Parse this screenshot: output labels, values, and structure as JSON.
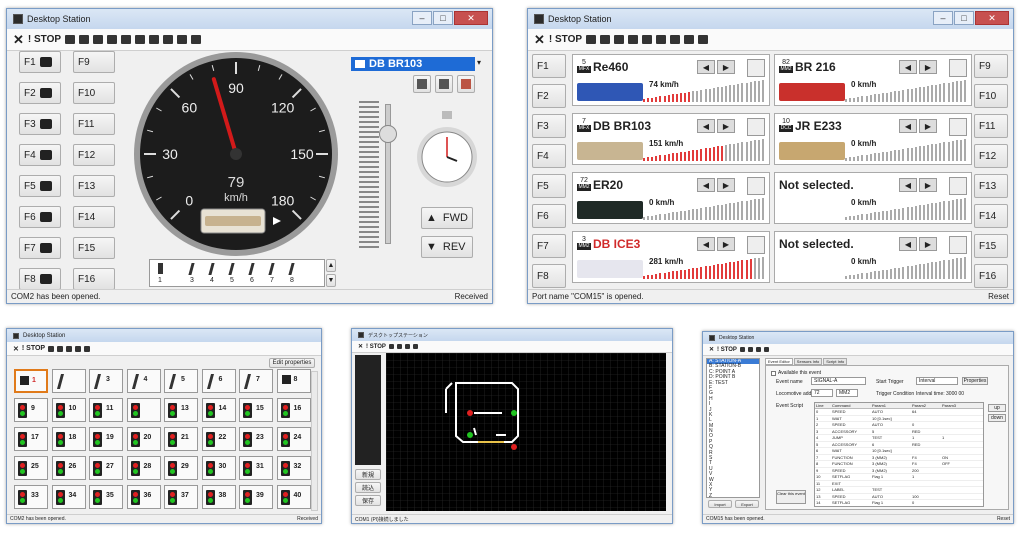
{
  "app_title": "Desktop Station",
  "toolbar": {
    "close": "✕",
    "stop": "! STOP"
  },
  "win1": {
    "f_left": [
      "F1",
      "F2",
      "F3",
      "F4",
      "F5",
      "F6",
      "F7",
      "F8"
    ],
    "f_right": [
      "F9",
      "F10",
      "F11",
      "F12",
      "F13",
      "F14",
      "F15",
      "F16"
    ],
    "loco_select": "DB BR103",
    "gauge_ticks": [
      "0",
      "30",
      "60",
      "90",
      "120",
      "150",
      "180"
    ],
    "speed": "79",
    "unit": "km/h",
    "fwd": "FWD",
    "rev": "REV",
    "accessory_nums": [
      "1",
      "3",
      "4",
      "5",
      "6",
      "7",
      "8"
    ],
    "status_left": "COM2 has been opened.",
    "status_right": "Received"
  },
  "win2": {
    "f_left": [
      "F1",
      "F2",
      "F3",
      "F4",
      "F5",
      "F6",
      "F7",
      "F8"
    ],
    "f_right": [
      "F9",
      "F10",
      "F11",
      "F12",
      "F13",
      "F14",
      "F15",
      "F16"
    ],
    "locos": [
      {
        "addr": "5",
        "type": "MFX",
        "name": "Re460",
        "speed": "74 km/h",
        "color": "#2f57b5",
        "fill": 0.4
      },
      {
        "addr": "82",
        "type": "MM2",
        "name": "BR 216",
        "speed": "0 km/h",
        "color": "#c9302c",
        "fill": 0
      },
      {
        "addr": "7",
        "type": "MFX",
        "name": "DB BR103",
        "speed": "151 km/h",
        "color": "#c8b592",
        "fill": 0.65
      },
      {
        "addr": "10",
        "type": "DCC",
        "name": "JR E233",
        "speed": "0 km/h",
        "color": "#c7a770",
        "fill": 0
      },
      {
        "addr": "72",
        "type": "MM2",
        "name": "ER20",
        "speed": "0 km/h",
        "color": "#1f2a26",
        "fill": 0
      },
      {
        "addr": "",
        "type": "",
        "name": "Not selected.",
        "speed": "0 km/h",
        "color": "",
        "fill": 0
      },
      {
        "addr": "3",
        "type": "MM2",
        "name": "DB ICE3",
        "speed": "281 km/h",
        "color": "#e6e6ee",
        "fill": 0.9
      },
      {
        "addr": "",
        "type": "",
        "name": "Not selected.",
        "speed": "0 km/h",
        "color": "",
        "fill": 0
      }
    ],
    "status_left": "Port name \"COM15\" is opened.",
    "status_right": "Reset"
  },
  "win3": {
    "edit_properties": "Edit properties",
    "tiles": [
      "1",
      "",
      "3",
      "4",
      "5",
      "6",
      "7",
      "8",
      "9",
      "10",
      "11",
      "",
      "13",
      "14",
      "15",
      "16",
      "17",
      "18",
      "19",
      "20",
      "21",
      "22",
      "23",
      "24",
      "25",
      "26",
      "27",
      "28",
      "29",
      "30",
      "31",
      "32",
      "33",
      "34",
      "35",
      "36",
      "37",
      "38",
      "39",
      "40"
    ],
    "status_left": "COM2 has been opened.",
    "status_right": "Received"
  },
  "win4": {
    "title": "デスクトップステーション",
    "side_buttons": [
      "新規",
      "読込",
      "保存"
    ],
    "status_left": "COM1 (Pl)接続しました"
  },
  "win5": {
    "list": [
      "A: STATION-A",
      "B: STATION-B",
      "C: POINT A",
      "D: POINT B",
      "E: TEST",
      "F",
      "G",
      "H",
      "I",
      "J",
      "K",
      "L",
      "M",
      "N",
      "O",
      "P",
      "Q",
      "R",
      "S",
      "T",
      "U",
      "V",
      "W",
      "X",
      "Y",
      "Z"
    ],
    "tabs": [
      "Event Editor",
      "Sensors Info",
      "Script Info"
    ],
    "available": "Available this event",
    "event_name_label": "Event name",
    "event_name": "SIGNAL-A",
    "loco_addr_label": "Locomotive address",
    "loco_addr": "72",
    "loco_proto": "MM2",
    "start_trigger_label": "Start Trigger",
    "start_trigger": "Interval",
    "properties": "Properties",
    "trigger_cond_label": "Trigger Condition",
    "trigger_cond": "Interval time: 3000 00",
    "script_label": "Event Script",
    "columns": [
      "Line",
      "Command",
      "Param1",
      "Param2",
      "Param3"
    ],
    "rows": [
      [
        "0",
        "SPEED",
        "AUTO",
        "64",
        ""
      ],
      [
        "1",
        "WAIT",
        "10 [0.1sec]",
        "",
        ""
      ],
      [
        "2",
        "SPEED",
        "AUTO",
        "0",
        ""
      ],
      [
        "3",
        "ACCESSORY",
        "5",
        "RED",
        ""
      ],
      [
        "4",
        "JUMP",
        "TEST",
        "1",
        "1"
      ],
      [
        "5",
        "ACCESSORY",
        "6",
        "RED",
        ""
      ],
      [
        "6",
        "WAIT",
        "10 [0.1sec]",
        "",
        ""
      ],
      [
        "7",
        "FUNCTION",
        "3 (MM2)",
        "F4",
        "ON"
      ],
      [
        "8",
        "FUNCTION",
        "3 (MM2)",
        "F4",
        "OFF"
      ],
      [
        "9",
        "SPEED",
        "3 (MM2)",
        "200",
        ""
      ],
      [
        "10",
        "SETFLAG",
        "Flag 1",
        "1",
        ""
      ],
      [
        "11",
        "EXIT",
        "",
        "",
        ""
      ],
      [
        "12",
        "LABEL",
        "TEST",
        "",
        ""
      ],
      [
        "13",
        "SPEED",
        "AUTO",
        "100",
        ""
      ],
      [
        "14",
        "SETFLAG",
        "Flag 1",
        "0",
        ""
      ]
    ],
    "clear_event": "Clear this event",
    "up": "up",
    "down": "down",
    "import": "Import",
    "export": "Export",
    "status_left": "COM15 has been opened.",
    "status_right": "Reset"
  }
}
